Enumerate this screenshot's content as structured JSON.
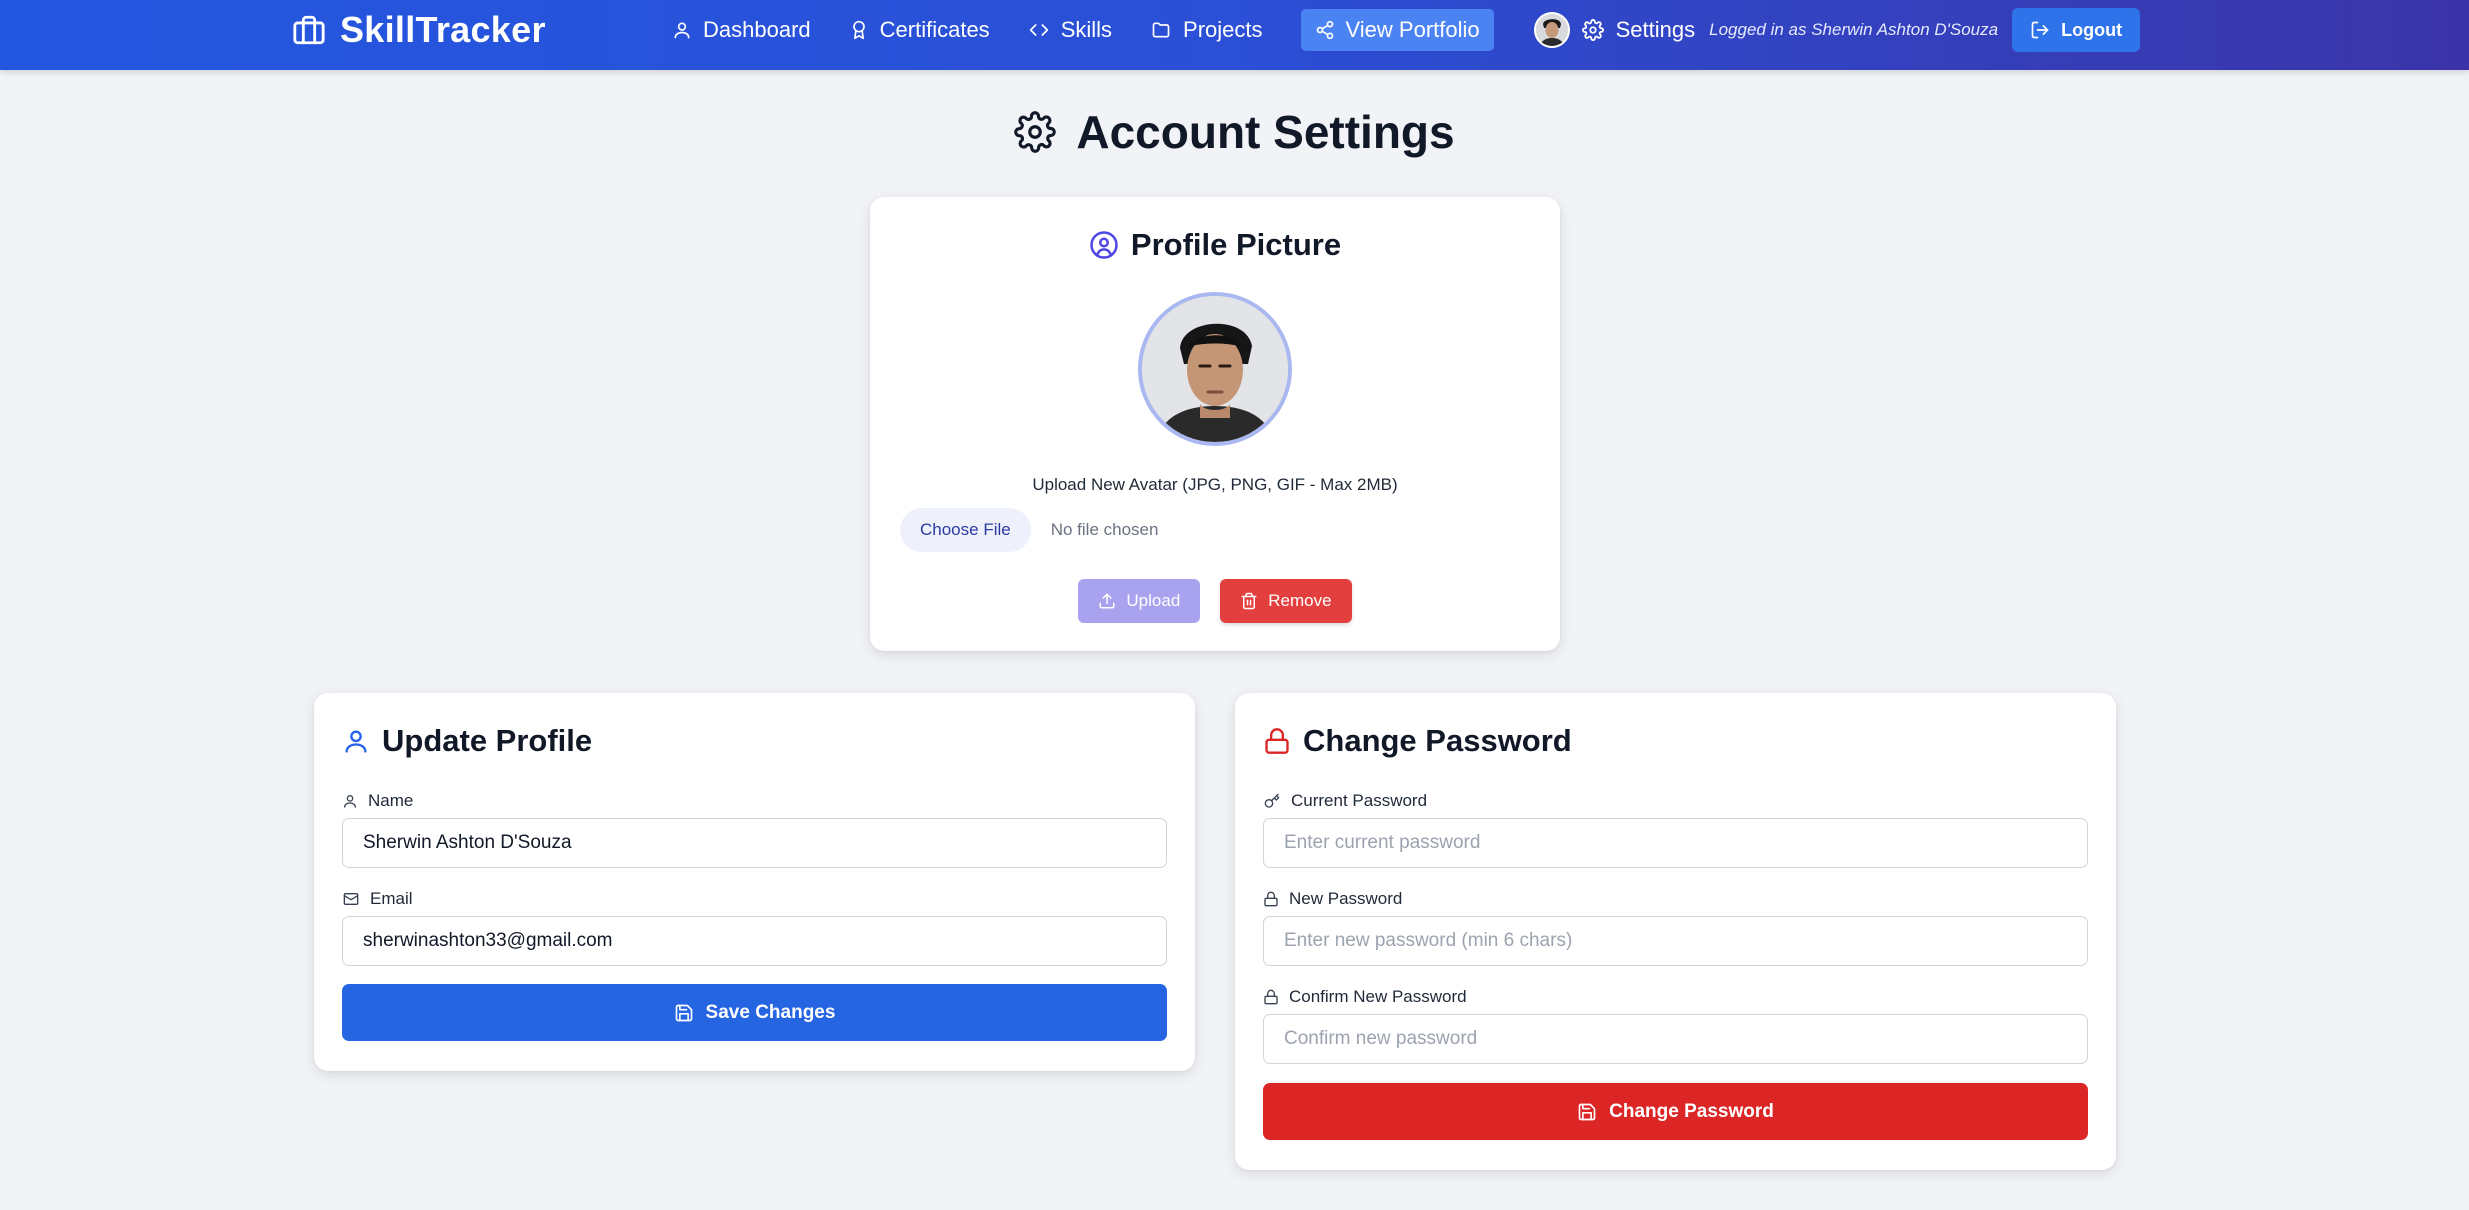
{
  "nav": {
    "brand": "SkillTracker",
    "links": {
      "dashboard": "Dashboard",
      "certificates": "Certificates",
      "skills": "Skills",
      "projects": "Projects"
    },
    "portfolio": "View Portfolio",
    "settings": "Settings",
    "logged_in": "Logged in as Sherwin Ashton D'Souza",
    "logout": "Logout"
  },
  "page": {
    "title": "Account Settings"
  },
  "avatar_card": {
    "title": "Profile Picture",
    "upload_label": "Upload New Avatar (JPG, PNG, GIF - Max 2MB)",
    "choose_file": "Choose File",
    "no_file": "No file chosen",
    "upload": "Upload",
    "remove": "Remove"
  },
  "profile_card": {
    "title": "Update Profile",
    "name_label": "Name",
    "name_value": "Sherwin Ashton D'Souza",
    "email_label": "Email",
    "email_value": "sherwinashton33@gmail.com",
    "save": "Save Changes"
  },
  "password_card": {
    "title": "Change Password",
    "current_label": "Current Password",
    "current_placeholder": "Enter current password",
    "new_label": "New Password",
    "new_placeholder": "Enter new password (min 6 chars)",
    "confirm_label": "Confirm New Password",
    "confirm_placeholder": "Confirm new password",
    "submit": "Change Password"
  },
  "colors": {
    "nav_gradient_start": "#2457e0",
    "nav_gradient_end": "#3b34a8",
    "primary": "#2565e2",
    "danger": "#dc2626",
    "upload_disabled": "#a9a3ef"
  }
}
